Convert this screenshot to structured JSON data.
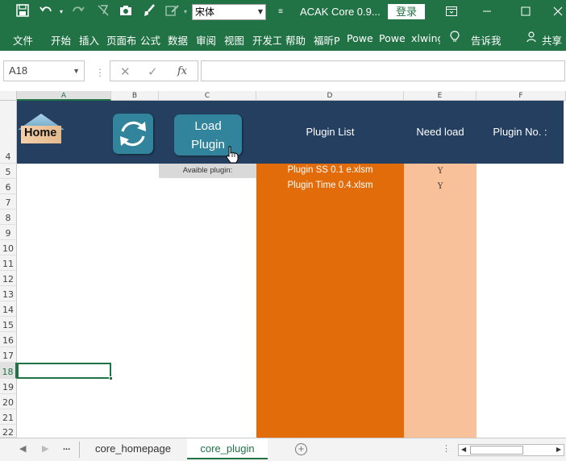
{
  "titlebar": {
    "font_name": "宋体",
    "doc_title": "ACAK Core 0.9...",
    "login": "登录",
    "icons": [
      "save-icon",
      "undo-icon",
      "redo-icon",
      "clear-format-icon",
      "camera-icon",
      "brush-icon",
      "pen-icon",
      "more-icon",
      "ribbon-display-icon",
      "minimize-icon",
      "maximize-icon",
      "close-icon"
    ]
  },
  "ribbon": {
    "tabs": [
      "文件",
      "开始",
      "插入",
      "页面布",
      "公式",
      "数据",
      "审阅",
      "视图",
      "开发工",
      "帮助",
      "福昕P",
      "Powe",
      "Powe",
      "xlwing"
    ],
    "tell_me": "告诉我",
    "share": "共享"
  },
  "formulabar": {
    "name_box": "A18",
    "fx": "fx",
    "value": ""
  },
  "sheet": {
    "columns": [
      "A",
      "B",
      "C",
      "D",
      "E",
      "F"
    ],
    "rows": [
      "4",
      "5",
      "6",
      "7",
      "8",
      "9",
      "10",
      "11",
      "12",
      "13",
      "14",
      "15",
      "16",
      "17",
      "18",
      "19",
      "20",
      "21",
      "22"
    ],
    "selected_cell": "A18",
    "home_label": "Home",
    "load_label_line1": "Load",
    "load_label_line2": "Plugin",
    "header_plugin_list": "Plugin List",
    "header_need_load": "Need load",
    "header_plugin_no": "Plugin No. :",
    "avail_label": "Avaible plugin:",
    "plugins": [
      {
        "name": "Plugin SS 0.1 e.xlsm",
        "need": "Y"
      },
      {
        "name": "Plugin Time 0.4.xlsm",
        "need": "Y"
      }
    ],
    "colors": {
      "banner": "#243f60",
      "plugin_col": "#e26b0a",
      "need_col": "#f8c19a",
      "button": "#31849b",
      "accent": "#217346"
    }
  },
  "tabs": {
    "ellipsis": "...",
    "sheets": [
      "core_homepage",
      "core_plugin"
    ],
    "active": "core_plugin"
  }
}
